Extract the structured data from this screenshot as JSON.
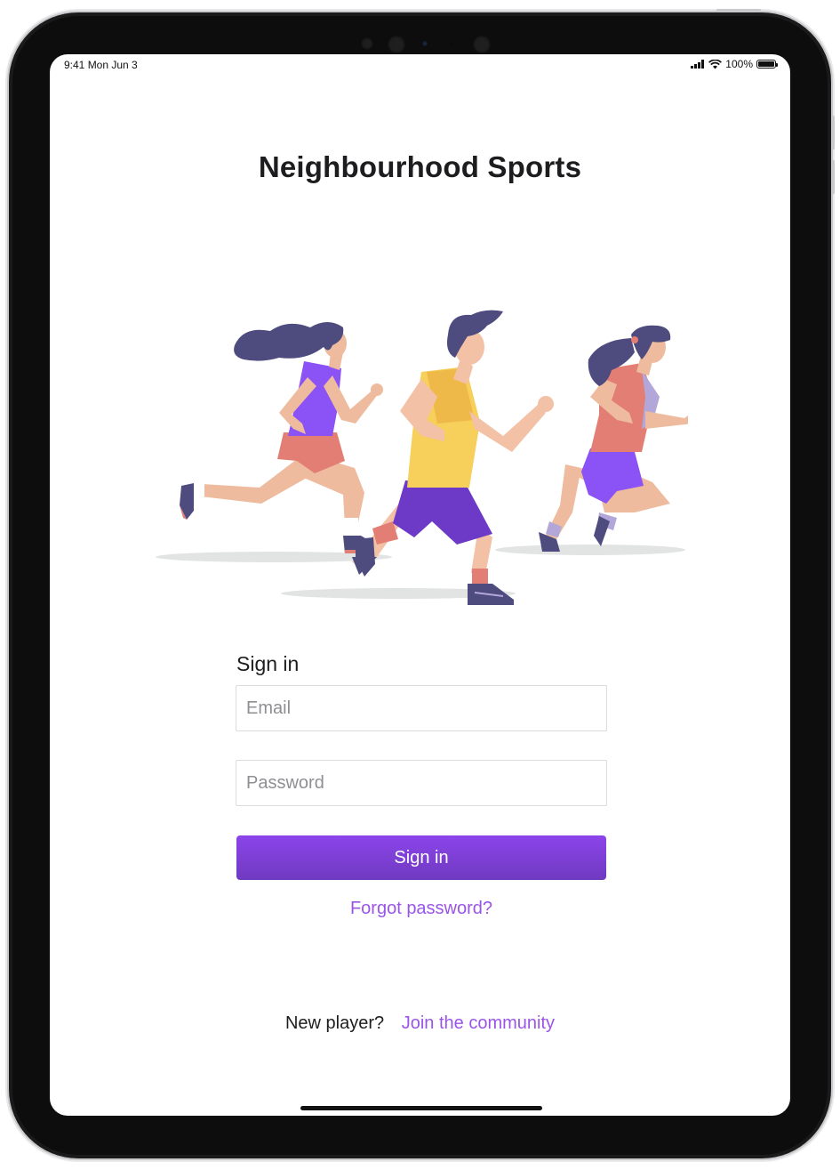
{
  "status_bar": {
    "time": "9:41  Mon Jun 3",
    "battery": "100%"
  },
  "app": {
    "title": "Neighbourhood Sports"
  },
  "illustration": {
    "name": "three-runners-illustration"
  },
  "signin_form": {
    "heading": "Sign in",
    "email_placeholder": "Email",
    "email_value": "",
    "password_placeholder": "Password",
    "password_value": "",
    "submit_label": "Sign in",
    "forgot_label": "Forgot password?"
  },
  "footer": {
    "prompt": "New player?",
    "join_label": "Join the community"
  },
  "colors": {
    "accent": "#9a55e8",
    "button_top": "#8c44ea",
    "button_bottom": "#6f3ac0",
    "text": "#1d1d1f"
  }
}
